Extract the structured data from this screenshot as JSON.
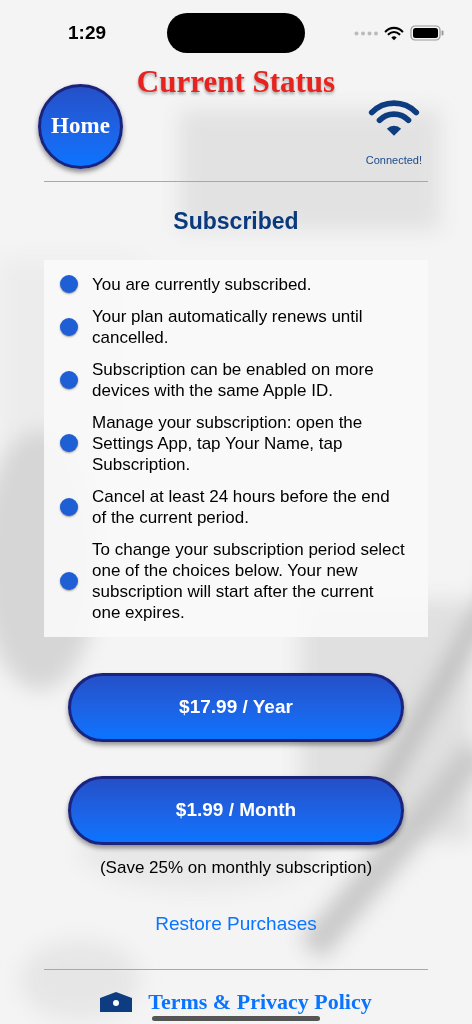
{
  "status_bar": {
    "time": "1:29"
  },
  "header": {
    "title": "Current Status",
    "home_button": "Home",
    "connection": {
      "label": "Connected!"
    }
  },
  "status_heading": "Subscribed",
  "info_items": [
    "You are currently subscribed.",
    "Your plan automatically renews until cancelled.",
    "Subscription can be enabled on more devices with the same Apple ID.",
    "Manage your subscription: open the Settings App, tap Your Name, tap Subscription.",
    "Cancel at least 24 hours before the end of the current period.",
    "To change your subscription period select one of the choices below. Your new subscription will start after the current one expires."
  ],
  "plans": [
    {
      "label": "$17.99 / Year"
    },
    {
      "label": "$1.99 / Month"
    }
  ],
  "savings_note": "(Save 25% on monthly subscription)",
  "restore_link": "Restore Purchases",
  "footer_link": "Terms & Privacy Policy"
}
